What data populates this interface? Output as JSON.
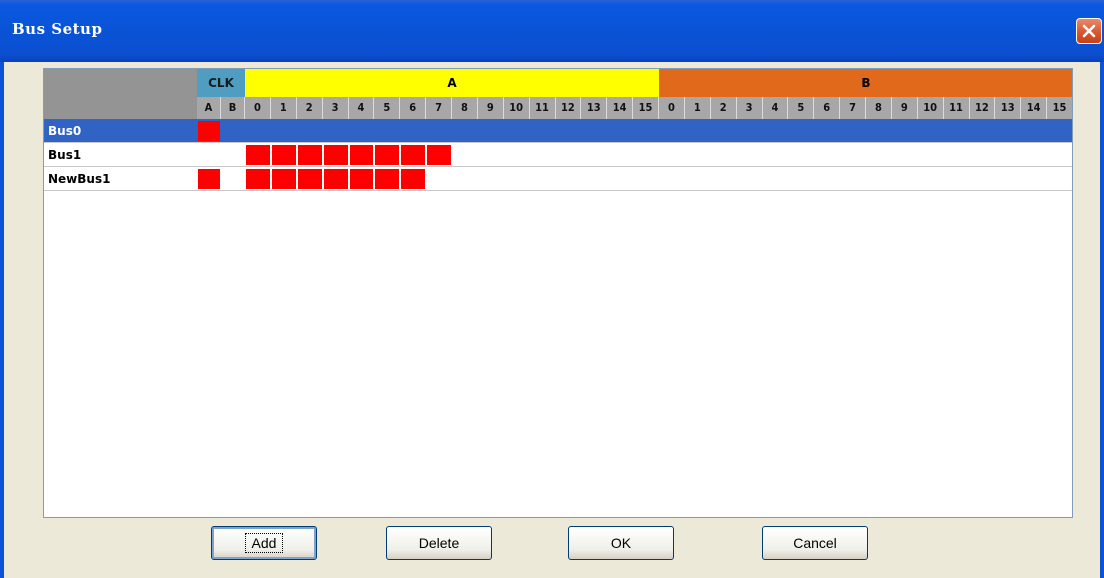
{
  "window": {
    "title": "Bus Setup",
    "close_icon": "close-icon",
    "colors": {
      "titlebar": "#0A59E0",
      "clk_header": "#4F9EC2",
      "group_a_header": "#FFFF00",
      "group_b_header": "#E0691C",
      "selected_row": "#3163C5",
      "assigned_cell": "#FF0000"
    }
  },
  "grid": {
    "groups": [
      {
        "label": "CLK",
        "columns": [
          "A",
          "B"
        ]
      },
      {
        "label": "A",
        "columns": [
          "0",
          "1",
          "2",
          "3",
          "4",
          "5",
          "6",
          "7",
          "8",
          "9",
          "10",
          "11",
          "12",
          "13",
          "14",
          "15"
        ]
      },
      {
        "label": "B",
        "columns": [
          "0",
          "1",
          "2",
          "3",
          "4",
          "5",
          "6",
          "7",
          "8",
          "9",
          "10",
          "11",
          "12",
          "13",
          "14",
          "15"
        ]
      }
    ],
    "rows": [
      {
        "name": "Bus0",
        "selected": true,
        "clk": [
          "A"
        ],
        "a": [],
        "b": []
      },
      {
        "name": "Bus1",
        "selected": false,
        "clk": [],
        "a": [
          "0",
          "1",
          "2",
          "3",
          "4",
          "5",
          "6",
          "7"
        ],
        "b": []
      },
      {
        "name": "NewBus1",
        "selected": false,
        "clk": [
          "A"
        ],
        "a": [
          "0",
          "1",
          "2",
          "3",
          "4",
          "5",
          "6"
        ],
        "b": []
      }
    ]
  },
  "buttons": {
    "add": "Add",
    "delete": "Delete",
    "ok": "OK",
    "cancel": "Cancel"
  }
}
